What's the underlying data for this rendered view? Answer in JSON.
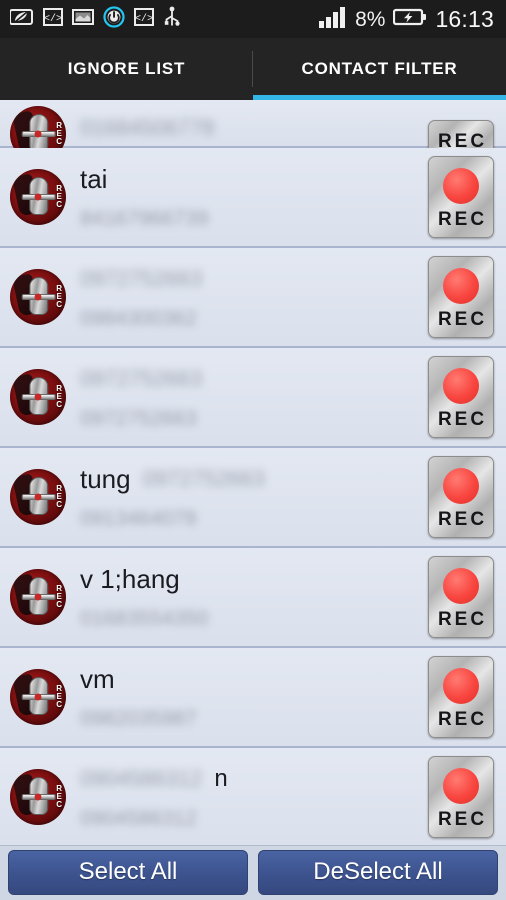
{
  "statusbar": {
    "icons": [
      {
        "name": "leaf-battery-saver-icon",
        "glyph": "leaf"
      },
      {
        "name": "code-tag-icon",
        "glyph": "</>"
      },
      {
        "name": "screenshot-image-icon",
        "glyph": "image"
      },
      {
        "name": "power-usb-debug-icon",
        "glyph": "power"
      },
      {
        "name": "code-tag-2-icon",
        "glyph": "</>"
      },
      {
        "name": "usb-icon",
        "glyph": "usb"
      }
    ],
    "signal_icon": "signal-bars-icon",
    "battery_percent": "8%",
    "battery_icon": "battery-charging-icon",
    "clock": "16:13"
  },
  "tabs": [
    {
      "label": "IGNORE LIST",
      "active": false
    },
    {
      "label": "CONTACT FILTER",
      "active": true
    }
  ],
  "rec_button": {
    "label": "REC",
    "dot_color": "#f8453f"
  },
  "avatar": {
    "name": "call-recorder-avatar",
    "vertical_label": [
      "R",
      "E",
      "C"
    ]
  },
  "list": {
    "rows": [
      {
        "clipped": true,
        "name": "",
        "suffix": "",
        "line1_blurred": "01684506778",
        "line2_blurred": ""
      },
      {
        "clipped": false,
        "name": "tai",
        "suffix": "",
        "line1_blurred": "",
        "line2_blurred": "84167966739"
      },
      {
        "clipped": false,
        "name": "",
        "suffix": "",
        "line1_blurred": "0972752663",
        "line2_blurred": "0984300362"
      },
      {
        "clipped": false,
        "name": "",
        "suffix": "",
        "line1_blurred": "0972752663",
        "line2_blurred": "0972752663"
      },
      {
        "clipped": false,
        "name": "tung",
        "suffix": "",
        "line1_blurred": "0972752663",
        "line2_blurred": "0913464078"
      },
      {
        "clipped": false,
        "name": "v 1;hang",
        "suffix": "",
        "line1_blurred": "",
        "line2_blurred": "01683554350"
      },
      {
        "clipped": false,
        "name": "vm",
        "suffix": "",
        "line1_blurred": "",
        "line2_blurred": "0982035987"
      },
      {
        "clipped": false,
        "name": "",
        "suffix": "n",
        "line1_blurred": "0904586312",
        "line2_blurred": "0904586312"
      }
    ]
  },
  "bottombar": {
    "select_all": "Select All",
    "deselect_all": "DeSelect All"
  },
  "colors": {
    "accent": "#33b5e5",
    "tabbar_bg": "#242424",
    "statusbar_bg": "#1c1c1c",
    "list_bg": "#dde3ee",
    "button_blue": "#3d5490",
    "rec_red": "#f8453f"
  }
}
